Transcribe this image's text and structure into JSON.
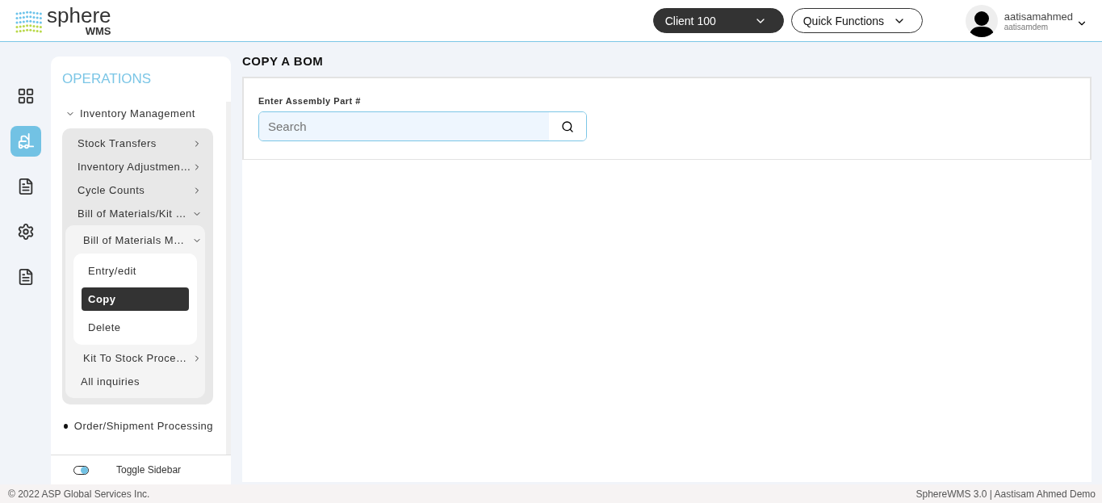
{
  "header": {
    "logo_name": "sphere",
    "logo_sub": "WMS",
    "client_select": "Client 100",
    "quick_functions": "Quick Functions",
    "user": {
      "name": "aatisamahmed",
      "login": "aatisamdem"
    }
  },
  "rail": [
    {
      "kind": "dashboard",
      "selected": false
    },
    {
      "kind": "forklift",
      "selected": true
    },
    {
      "kind": "checklist",
      "selected": false
    },
    {
      "kind": "gear",
      "selected": false
    },
    {
      "kind": "checklist",
      "selected": false
    }
  ],
  "sidebar": {
    "title": "OPERATIONS",
    "items": [
      {
        "label": "Inventory Management",
        "kind": "group",
        "expanded": true,
        "children": [
          {
            "label": "Stock Transfers",
            "kind": "branch",
            "expanded": false
          },
          {
            "label": "Inventory Adjustmen…",
            "kind": "branch",
            "expanded": false
          },
          {
            "label": "Cycle Counts",
            "kind": "branch",
            "expanded": false
          },
          {
            "label": "Bill of Materials/Kit …",
            "kind": "branch",
            "expanded": true,
            "children": [
              {
                "label": "Bill of Materials M…",
                "kind": "branch",
                "expanded": true,
                "children": [
                  {
                    "label": "Entry/edit",
                    "kind": "leaf",
                    "selected": false
                  },
                  {
                    "label": "Copy",
                    "kind": "leaf",
                    "selected": true
                  },
                  {
                    "label": "Delete",
                    "kind": "leaf",
                    "selected": false
                  }
                ]
              },
              {
                "label": "Kit To Stock Proce…",
                "kind": "branch",
                "expanded": false
              },
              {
                "label": "All inquiries",
                "kind": "link"
              }
            ]
          }
        ]
      },
      {
        "label": "Order/Shipment Processing",
        "kind": "bullet"
      }
    ],
    "toggle": {
      "label": "Toggle Sidebar",
      "on": true
    }
  },
  "page": {
    "title": "COPY A BOM",
    "field_label": "Enter Assembly Part #",
    "search": {
      "placeholder": "Search"
    }
  },
  "footer": {
    "copyright": "© 2022 ASP Global Services Inc.",
    "version": "SphereWMS 3.0 | Aastisam Ahmed Demo"
  }
}
